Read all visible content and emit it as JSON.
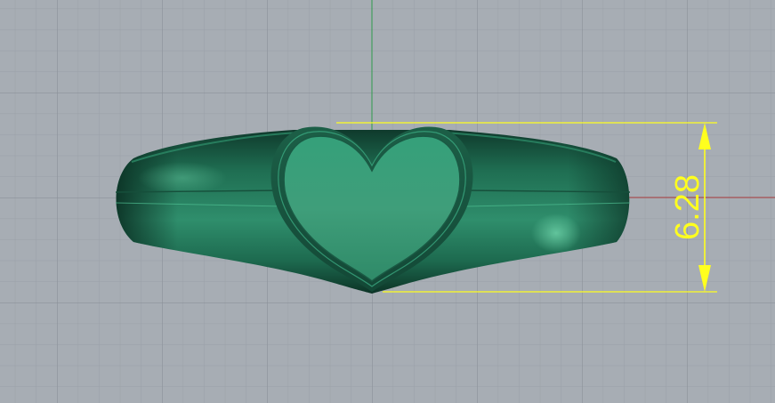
{
  "viewport": {
    "background": "#a7adb4",
    "grid_minor_color": "#9aa0a8",
    "grid_major_color": "#7f858d",
    "axis_x_color": "#b23a3a",
    "axis_y_color": "#2e9a4a"
  },
  "model": {
    "shape": "heart signet ring",
    "color": "#2f8a6a"
  },
  "dimension": {
    "value": "6.28",
    "color": "#ffff1e"
  }
}
